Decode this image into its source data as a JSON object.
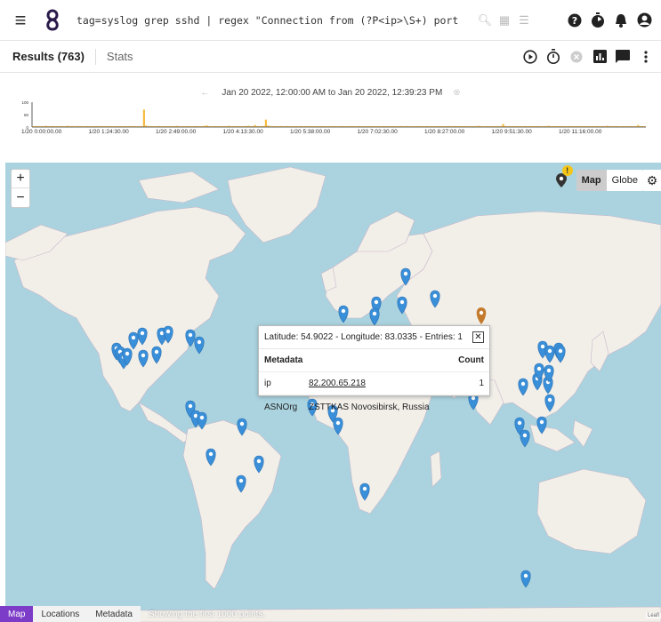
{
  "topbar": {
    "menu_icon": "hamburger-menu-icon",
    "logo_icon": "gravwell-logo-icon",
    "query": "tag=syslog grep sshd | regex \"Connection from (?P<ip>\\S+) port\" | geoi…",
    "query_icons": [
      "search-icon",
      "calendar-icon",
      "list-icon"
    ],
    "right_icons": [
      "help-icon",
      "timer-icon",
      "bell-icon",
      "account-icon"
    ]
  },
  "subbar": {
    "results_label": "Results (763)",
    "stats_label": "Stats",
    "icons": [
      "play-icon",
      "stopwatch-icon",
      "cancel-icon",
      "chart-icon",
      "comment-icon",
      "more-vert-icon"
    ]
  },
  "timeline": {
    "range": "Jan 20 2022, 12:00:00 AM to Jan 20 2022, 12:39:23 PM",
    "y_ticks": [
      "100",
      "50",
      "0"
    ],
    "x_ticks": [
      "1/20 0:00:00.00",
      "1/20 1:24:30.00",
      "1/20 2:49:00.00",
      "1/20 4:13:30.00",
      "1/20 5:38:00.00",
      "1/20 7:02:30.00",
      "1/20 8:27:00.00",
      "1/20 9:51:30.00",
      "1/20 11:16:00.00"
    ],
    "bar_color": "#f6b93b",
    "bars": [
      3,
      2,
      4,
      3,
      2,
      3,
      5,
      3,
      2,
      4,
      3,
      2,
      3,
      4,
      3,
      2,
      5,
      3,
      4,
      2,
      3,
      4,
      3,
      2,
      3,
      4,
      2,
      3,
      3,
      4,
      2,
      3,
      4,
      2,
      3,
      4,
      3,
      2,
      3,
      2,
      4,
      3,
      2,
      3,
      2,
      3,
      4,
      3,
      2,
      3,
      2,
      70,
      6,
      3,
      4,
      3,
      2,
      3,
      4,
      2,
      3,
      2,
      4,
      3,
      2,
      3,
      5,
      3,
      2,
      3,
      2,
      4,
      3,
      2,
      3,
      4,
      2,
      3,
      2,
      5,
      6,
      3,
      2,
      3,
      4,
      3,
      2,
      3,
      2,
      3,
      5,
      3,
      2,
      3,
      4,
      3,
      2,
      3,
      4,
      5,
      2,
      3,
      8,
      3,
      2,
      3,
      4,
      30,
      6,
      3,
      4,
      3,
      2,
      3,
      4,
      2,
      3,
      4,
      3,
      2,
      3,
      2,
      3,
      4,
      3,
      2,
      3,
      4,
      3,
      2,
      3,
      2,
      4,
      3,
      2,
      3,
      2,
      3,
      4,
      3,
      2,
      3,
      4,
      3,
      2,
      3,
      4,
      3,
      2,
      3,
      4,
      3,
      2,
      3,
      2,
      4,
      3,
      2,
      3,
      2,
      3,
      4,
      3,
      2,
      3,
      4,
      3,
      2,
      3,
      4,
      2,
      3,
      4,
      3,
      2,
      3,
      2,
      4,
      3,
      2,
      3,
      4,
      3,
      2,
      3,
      2,
      3,
      4,
      3,
      2,
      3,
      4,
      2,
      3,
      4,
      3,
      2,
      3,
      2,
      4,
      3,
      2,
      3,
      2,
      4,
      5,
      3,
      2,
      3,
      4,
      3,
      2,
      3,
      4,
      2,
      3,
      12,
      4,
      3,
      2,
      3,
      4,
      3,
      2,
      3,
      2,
      4,
      3,
      2,
      3,
      2,
      3,
      4,
      3,
      2,
      3,
      4,
      5,
      3,
      2,
      3,
      2,
      3,
      4,
      3,
      2,
      3,
      4,
      3,
      2,
      3,
      4,
      2,
      3,
      4,
      3,
      2,
      3,
      2,
      4,
      3,
      2,
      3,
      4,
      5,
      3,
      2,
      3,
      4,
      3,
      2,
      3,
      2,
      3,
      4,
      3,
      2,
      3,
      8,
      3,
      2,
      3
    ]
  },
  "map": {
    "zoom_in": "+",
    "zoom_out": "−",
    "layer_icon": "map-marker-icon",
    "badge": "!",
    "mode_map": "Map",
    "mode_globe": "Globe",
    "settings_icon": "gear-icon",
    "marker_color": "#3a8fd9",
    "selected_marker_color": "#c47a2c",
    "popup": {
      "header": "Latitude: 54.9022 - Longitude: 83.0335 - Entries: 1",
      "close_icon": "close-icon",
      "col_metadata": "Metadata",
      "col_count": "Count",
      "rows": [
        {
          "key": "ip",
          "value": "82.200.65.218",
          "count": "1"
        },
        {
          "key": "ASNOrg",
          "value": "ZSTTKAS Novosibirsk, Russia",
          "count": ""
        }
      ]
    },
    "attribution": "Leafl"
  },
  "bottom_tabs": {
    "map": "Map",
    "locations": "Locations",
    "metadata": "Metadata",
    "note": "Showing the first 1000 points."
  }
}
